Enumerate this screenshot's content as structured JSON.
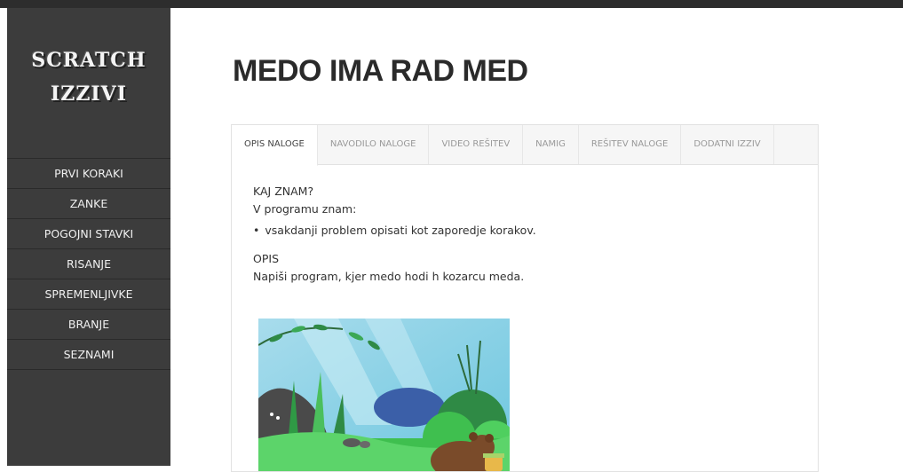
{
  "sidebar": {
    "logo_line1": "SCRATCH",
    "logo_line2": "IZZIVI",
    "items": [
      {
        "label": "PRVI KORAKI"
      },
      {
        "label": "ZANKE"
      },
      {
        "label": "POGOJNI STAVKI"
      },
      {
        "label": "RISANJE"
      },
      {
        "label": "SPREMENLJIVKE"
      },
      {
        "label": "BRANJE"
      },
      {
        "label": "SEZNAMI"
      }
    ]
  },
  "page": {
    "title": "MEDO IMA RAD MED"
  },
  "tabs": [
    {
      "label": "OPIS NALOGE",
      "active": true
    },
    {
      "label": "NAVODILO NALOGE",
      "active": false
    },
    {
      "label": "VIDEO REŠITEV",
      "active": false
    },
    {
      "label": "NAMIG",
      "active": false
    },
    {
      "label": "REŠITEV NALOGE",
      "active": false
    },
    {
      "label": "DODATNI IZZIV",
      "active": false
    }
  ],
  "content": {
    "know_heading": "KAJ ZNAM?",
    "know_intro": "V programu znam:",
    "know_items": [
      "vsakdanji problem opisati kot zaporedje korakov."
    ],
    "desc_heading": "OPIS",
    "desc_text": "Napiši program, kjer medo hodi h kozarcu meda."
  },
  "colors": {
    "sidebar": "#3c3c3c",
    "topbar": "#2d2d2d",
    "accent_green": "#3fbf4f"
  }
}
